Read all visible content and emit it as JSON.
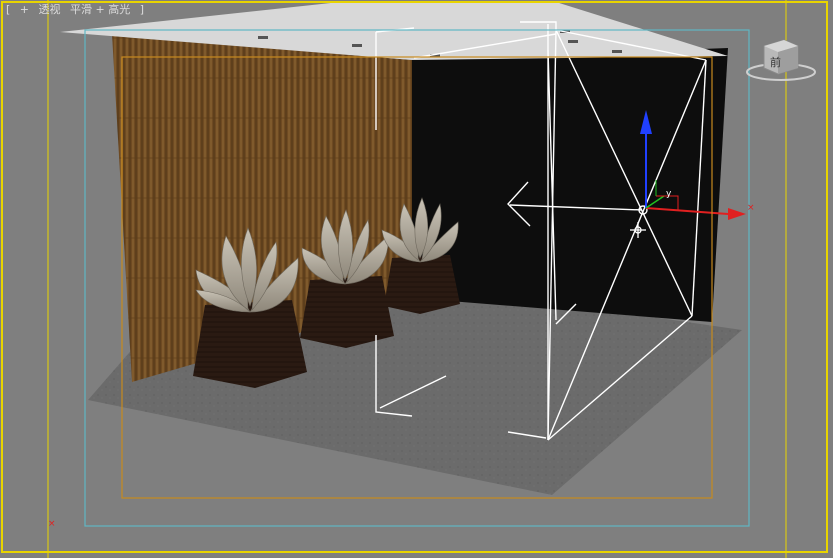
{
  "viewport": {
    "labels": {
      "open_bracket": "[",
      "plus_menu": "+",
      "point_of_view": "透视",
      "shading": "平滑 + 高光",
      "close_bracket": "]"
    },
    "viewcube_face": "前",
    "gizmo_y_label": "y"
  },
  "colors": {
    "active_border": "#e8d400",
    "safe_frame_outer": "#5fb7c4",
    "safe_frame_inner": "#c88a1e",
    "x_axis": "#e02020",
    "y_axis": "#20c020",
    "z_axis": "#2040ff",
    "viewport_bg": "#7f7f7f"
  },
  "icons": [
    "viewcube-icon",
    "move-cursor-icon",
    "transform-gizmo-icon",
    "camera-target-icon"
  ]
}
